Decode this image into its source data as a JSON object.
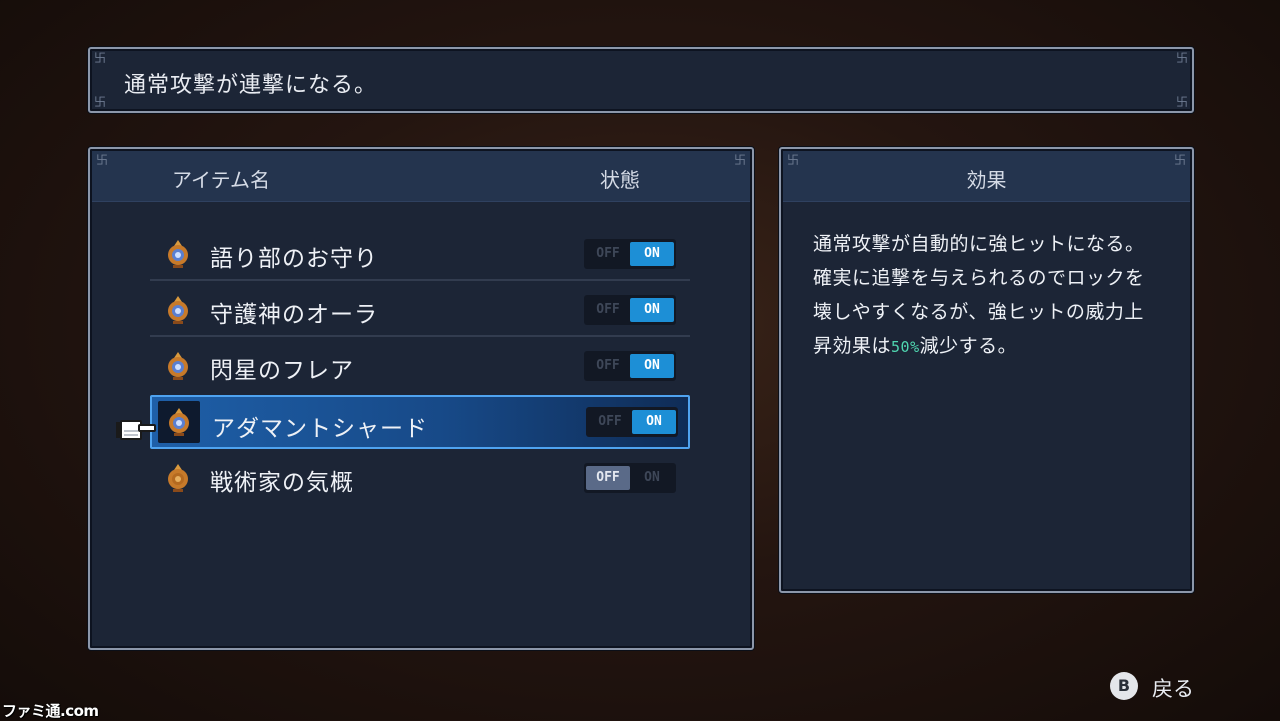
{
  "description_bar": {
    "text": "通常攻撃が連撃になる。"
  },
  "item_list": {
    "header_name": "アイテム名",
    "header_state": "状態",
    "toggle_off_label": "OFF",
    "toggle_on_label": "ON",
    "items": [
      {
        "label": "語り部のお守り",
        "state": "ON",
        "icon": "amulet-icon"
      },
      {
        "label": "守護神のオーラ",
        "state": "ON",
        "icon": "amulet-icon"
      },
      {
        "label": "閃星のフレア",
        "state": "ON",
        "icon": "amulet-icon"
      },
      {
        "label": "アダマントシャード",
        "state": "ON",
        "icon": "amulet-icon",
        "selected": true
      },
      {
        "label": "戦術家の気概",
        "state": "OFF",
        "icon": "amulet-icon"
      }
    ]
  },
  "effect": {
    "title": "効果",
    "line1": "通常攻撃が自動的に強ヒットになる。",
    "line2": "確実に追撃を与えられるのでロックを",
    "line3": "壊しやすくなるが、強ヒットの威力上",
    "line4_pre": "昇効果は",
    "line4_value": "50%",
    "line4_post": "減少する。"
  },
  "back_button": {
    "glyph": "B",
    "label": "戻る"
  },
  "watermark": "ファミ通.com",
  "colors": {
    "accent_on": "#1d8fd6",
    "selection": "#4fa3f0",
    "highlight_value": "#4fd6b0"
  }
}
